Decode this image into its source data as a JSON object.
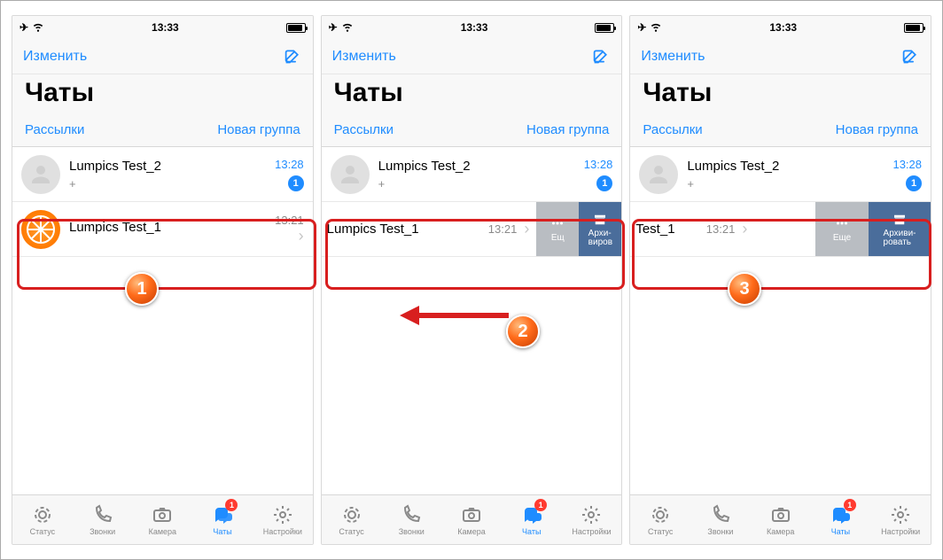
{
  "status": {
    "time": "13:33"
  },
  "nav": {
    "edit": "Изменить"
  },
  "header": {
    "title": "Чаты"
  },
  "subbar": {
    "broadcasts": "Рассылки",
    "newgroup": "Новая группа"
  },
  "chats": [
    {
      "name": "Lumpics Test_2",
      "preview": "+",
      "time": "13:28",
      "unread": "1"
    },
    {
      "name": "Lumpics Test_1",
      "preview": "",
      "time": "13:21"
    }
  ],
  "swiped": {
    "s1_name": "Lumpics Test_1",
    "s2_name": "Test_1",
    "more": "Еще",
    "more_trunc": "Ещ",
    "archive_full": "Архи-\nвиров",
    "archive_full_line1": "Архи-",
    "archive_full_line2": "виров",
    "archive_wide_line1": "Архиви-",
    "archive_wide_line2": "ровать"
  },
  "tabs": {
    "status": "Статус",
    "calls": "Звонки",
    "camera": "Камера",
    "chats": "Чаты",
    "settings": "Настройки",
    "badge": "1"
  },
  "callouts": {
    "c1": "1",
    "c2": "2",
    "c3": "3"
  }
}
